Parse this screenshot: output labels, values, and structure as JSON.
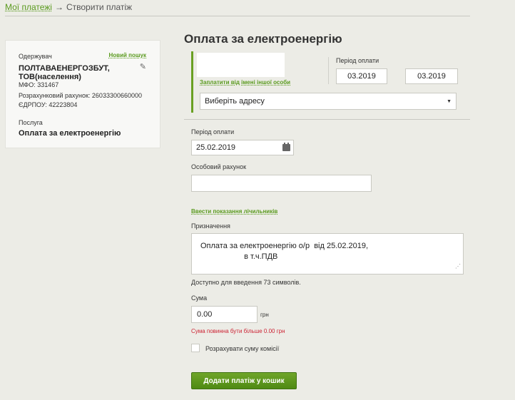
{
  "breadcrumb": {
    "home": "Мої платежі",
    "arrow": "→",
    "current": "Створити платіж"
  },
  "recipient": {
    "label": "Одержувач",
    "new_search": "Новий пошук",
    "company": "ПОЛТАВАЕНЕРГОЗБУТ, ТОВ(населення)",
    "mfo": "МФО: 331467",
    "account": "Розрахунковий рахунок: 26033300660000",
    "edrpou": "ЄДРПОУ: 42223804",
    "service_label": "Послуга",
    "service": "Оплата за електроенергію"
  },
  "form": {
    "title": "Оплата за електроенергію",
    "pay_other": "Заплатити від імені іншої особи",
    "period_label_top": "Період оплати",
    "period_from": "03.2019",
    "period_to": "03.2019",
    "address_select": "Виберіть адресу",
    "period_label": "Період оплати",
    "date": "25.02.2019",
    "account_label": "Особовий рахунок",
    "account_value": "",
    "meters_link": "Ввести показання лічильників",
    "purpose_label": "Призначення",
    "purpose_text": "Оплата за електроенергію о/р  від 25.02.2019,\n                    в т.ч.ПДВ",
    "available": "Доступно для введення 73 символів.",
    "sum_label": "Сума",
    "sum_value": "0.00",
    "currency": "грн",
    "error": "Сума повинна бути більше 0.00 грн",
    "commission_label": "Розрахувати суму комісії",
    "submit": "Додати платіж у кошик"
  },
  "colors": {
    "accent": "#5a9a1e",
    "error": "#cc2233",
    "button": "#5a9a1e"
  }
}
